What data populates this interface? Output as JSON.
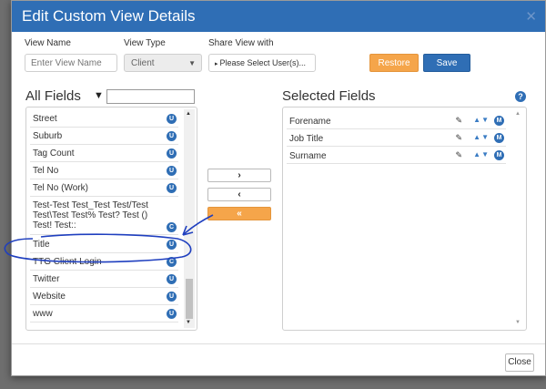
{
  "dialog": {
    "title": "Edit Custom View Details",
    "close_symbol": "✕",
    "close_button_label": "Close"
  },
  "form": {
    "view_name_label": "View Name",
    "view_name_placeholder": "Enter View Name",
    "view_type_label": "View Type",
    "view_type_value": "Client",
    "share_label": "Share View with",
    "share_value": "Please Select User(s)...",
    "restore_label": "Restore",
    "save_label": "Save"
  },
  "all_fields": {
    "title": "All Fields",
    "items": [
      {
        "label": "Street",
        "badge": "U"
      },
      {
        "label": "Suburb",
        "badge": "U"
      },
      {
        "label": "Tag Count",
        "badge": "U"
      },
      {
        "label": "Tel No",
        "badge": "U"
      },
      {
        "label": "Tel No (Work)",
        "badge": "U"
      },
      {
        "label": "Test-Test Test_Test Test/Test Test\\Test Test% Test? Test () Test! Test::",
        "badge": "C"
      },
      {
        "label": "Title",
        "badge": "U"
      },
      {
        "label": "TTG Client Login",
        "badge": "C"
      },
      {
        "label": "Twitter",
        "badge": "U"
      },
      {
        "label": "Website",
        "badge": "U"
      },
      {
        "label": "www",
        "badge": "U"
      }
    ]
  },
  "move_buttons": {
    "add": "›",
    "remove": "‹",
    "remove_all": "«"
  },
  "selected_fields": {
    "title": "Selected Fields",
    "help": "?",
    "items": [
      {
        "label": "Forename",
        "badge": "M"
      },
      {
        "label": "Job Title",
        "badge": "M"
      },
      {
        "label": "Surname",
        "badge": "M"
      }
    ]
  },
  "icons": {
    "filter": "filter-icon",
    "pencil": "pencil-icon",
    "sort": "sort-arrows-icon"
  },
  "colors": {
    "header": "#2f6eb5",
    "accent_orange": "#f5a54a",
    "annotation_ink": "#1f3fbf"
  }
}
